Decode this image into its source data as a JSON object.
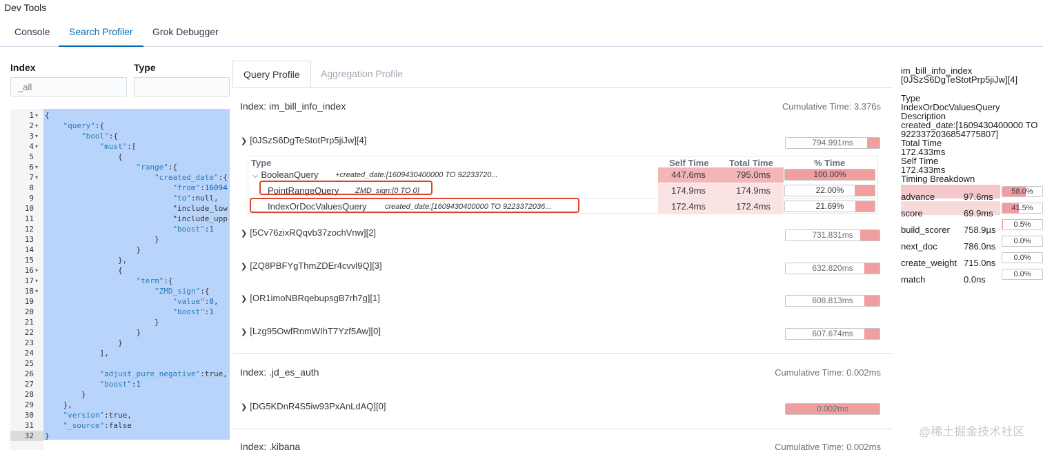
{
  "app": {
    "title": "Dev Tools"
  },
  "tabs": [
    {
      "label": "Console"
    },
    {
      "label": "Search Profiler"
    },
    {
      "label": "Grok Debugger"
    }
  ],
  "form": {
    "index_label": "Index",
    "index_placeholder": "_all",
    "type_label": "Type",
    "type_value": ""
  },
  "editor": {
    "line_numbers": [
      "1",
      "2",
      "3",
      "4",
      "5",
      "6",
      "7",
      "8",
      "9",
      "10",
      "11",
      "12",
      "13",
      "14",
      "15",
      "16",
      "17",
      "18",
      "19",
      "20",
      "21",
      "22",
      "23",
      "24",
      "25",
      "26",
      "27",
      "28",
      "29",
      "30",
      "31",
      "32"
    ],
    "lines": [
      "{",
      "    \"query\":{",
      "        \"bool\":{",
      "            \"must\":[",
      "                {",
      "                    \"range\":{",
      "                        \"created_date\":{",
      "                            \"from\":16094",
      "                            \"to\":null,",
      "                            \"include_low",
      "                            \"include_upp",
      "                            \"boost\":1",
      "                        }",
      "                    }",
      "                },",
      "                {",
      "                    \"term\":{",
      "                        \"ZMD_sign\":{",
      "                            \"value\":0,",
      "                            \"boost\":1",
      "                        }",
      "                    }",
      "                }",
      "            ],",
      "",
      "            \"adjust_pure_negative\":true,",
      "            \"boost\":1",
      "        }",
      "    },",
      "    \"version\":true,",
      "    \"_source\":false",
      "}"
    ]
  },
  "profile_tabs": [
    {
      "label": "Query Profile"
    },
    {
      "label": "Aggregation Profile"
    }
  ],
  "indices": [
    {
      "name": "Index: im_bill_info_index",
      "cumulative": "Cumulative Time: 3.376s",
      "shards": [
        {
          "label": "[0JSzS6DgTeStotPrp5jiJw][4]",
          "time": "794.991ms",
          "pct": 0.1
        },
        {
          "label": "[5Cv76zixRQqvb37zochVnw][2]",
          "time": "731.831ms",
          "pct": 0.1
        },
        {
          "label": "[ZQ8PBFYgThmZDEr4cvvl9Q][3]",
          "time": "632.820ms",
          "pct": 0.1
        },
        {
          "label": "[OR1imoNBRqebupsgB7rh7g][1]",
          "time": "608.813ms",
          "pct": 0.1
        },
        {
          "label": "[Lzg95OwfRnmWIhT7Yzf5Aw][0]",
          "time": "607.674ms",
          "pct": 0.1
        }
      ]
    },
    {
      "name": "Index: .jd_es_auth",
      "cumulative": "Cumulative Time: 0.002ms",
      "shards": [
        {
          "label": "[DG5KDnR4S5iw93PxAnLdAQ][0]",
          "time": "0.002ms",
          "pct": 1.0
        }
      ]
    },
    {
      "name": "Index: .kibana",
      "cumulative": "Cumulative Time: 0.002ms",
      "shards": []
    }
  ],
  "query_table": {
    "headers": {
      "type": "Type",
      "self": "Self Time",
      "total": "Total Time",
      "pct": "% Time"
    },
    "rows": [
      {
        "name": "BooleanQuery",
        "desc": "+created_date:[1609430400000 TO 92233720...",
        "self": "447.6ms",
        "total": "795.0ms",
        "pct_text": "100.00%",
        "pct": 1.0
      },
      {
        "name": "PointRangeQuery",
        "desc": "ZMD_sign:[0 TO 0]",
        "self": "174.9ms",
        "total": "174.9ms",
        "pct_text": "22.00%",
        "pct": 0.22
      },
      {
        "name": "IndexOrDocValuesQuery",
        "desc": "created_date:[1609430400000 TO 9223372036...",
        "self": "172.4ms",
        "total": "172.4ms",
        "pct_text": "21.69%",
        "pct": 0.2169
      }
    ]
  },
  "detail": {
    "index": "im_bill_info_index",
    "shard": "[0JSzS6DgTeStotPrp5jiJw][4]",
    "type_label": "Type",
    "type_value": "IndexOrDocValuesQuery",
    "desc_label": "Description",
    "desc_value_1": "created_date:[1609430400000 TO",
    "desc_value_2": "9223372036854775807]",
    "total_label": "Total Time",
    "total_value": "172.433ms",
    "self_label": "Self Time",
    "self_value": "172.433ms",
    "breakdown_label": "Timing Breakdown",
    "breakdown": [
      {
        "name": "advance",
        "value": "97.6ms",
        "pct_text": "58.0%",
        "pct": 0.58
      },
      {
        "name": "score",
        "value": "69.9ms",
        "pct_text": "41.5%",
        "pct": 0.415
      },
      {
        "name": "build_scorer",
        "value": "758.9µs",
        "pct_text": "0.5%",
        "pct": 0.005
      },
      {
        "name": "next_doc",
        "value": "786.0ns",
        "pct_text": "0.0%",
        "pct": 0
      },
      {
        "name": "create_weight",
        "value": "715.0ns",
        "pct_text": "0.0%",
        "pct": 0
      },
      {
        "name": "match",
        "value": "0.0ns",
        "pct_text": "0.0%",
        "pct": 0
      }
    ]
  },
  "watermark": "@稀土掘金技术社区",
  "colors": {
    "accent": "#006bb4",
    "bar_fill": "#f19ea0",
    "highlight": "#e0432f",
    "selection": "#b9d4fb"
  }
}
